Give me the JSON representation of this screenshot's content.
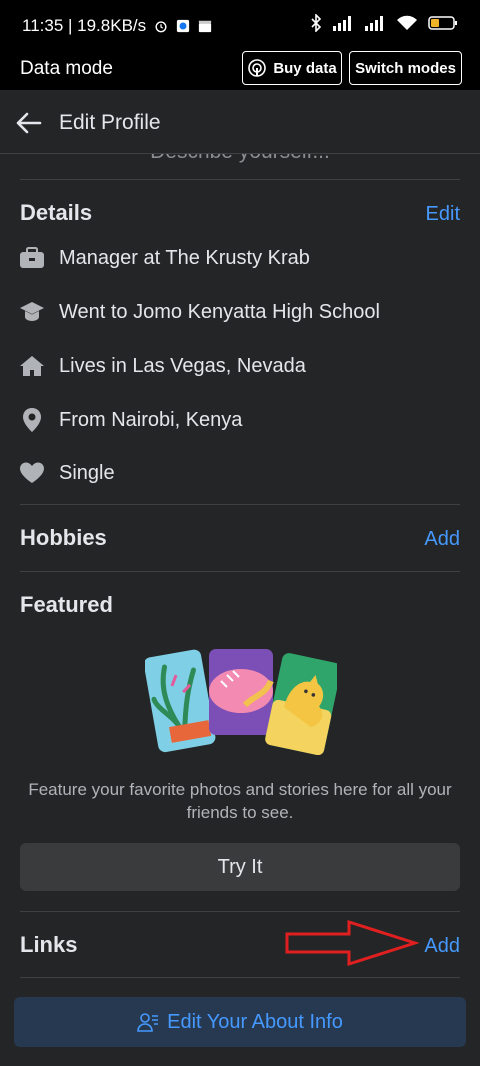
{
  "status_bar": {
    "time_speed": "11:35 | 19.8KB/s",
    "icons": [
      "alarm-icon",
      "messenger-icon",
      "clapper-icon",
      "bluetooth-icon",
      "signal-icon",
      "signal-icon",
      "wifi-icon",
      "battery-icon"
    ]
  },
  "data_mode": {
    "title": "Data mode",
    "buy_label": "Buy data",
    "switch_label": "Switch modes"
  },
  "header": {
    "title": "Edit Profile"
  },
  "bio": {
    "placeholder": "Describe yourself..."
  },
  "details": {
    "title": "Details",
    "edit_label": "Edit",
    "items": [
      {
        "icon": "briefcase-icon",
        "text": "Manager at The Krusty Krab"
      },
      {
        "icon": "graduation-cap-icon",
        "text": "Went to Jomo Kenyatta High School"
      },
      {
        "icon": "home-icon",
        "text": "Lives in Las Vegas, Nevada"
      },
      {
        "icon": "location-pin-icon",
        "text": "From Nairobi, Kenya"
      },
      {
        "icon": "heart-icon",
        "text": "Single"
      }
    ]
  },
  "hobbies": {
    "title": "Hobbies",
    "add_label": "Add"
  },
  "featured": {
    "title": "Featured",
    "caption": "Feature your favorite photos and stories here for all your friends to see.",
    "try_label": "Try It"
  },
  "links": {
    "title": "Links",
    "add_label": "Add"
  },
  "footer": {
    "about_label": "Edit Your About Info"
  },
  "colors": {
    "accent": "#4599ff",
    "background": "#242526",
    "arrow": "#e02020"
  }
}
